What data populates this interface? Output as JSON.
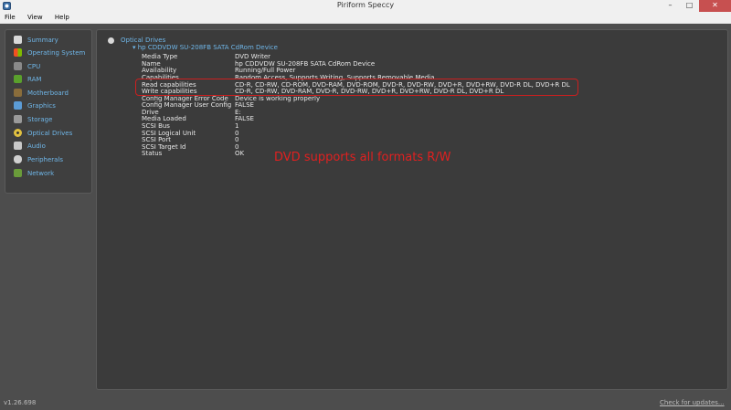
{
  "window": {
    "title": "Piriform Speccy"
  },
  "menu": [
    "File",
    "View",
    "Help"
  ],
  "sidebar": {
    "items": [
      {
        "label": "Summary",
        "icon": "summary-icon",
        "color": "#d9d9d9"
      },
      {
        "label": "Operating System",
        "icon": "windows-logo-icon",
        "color": "#f25022"
      },
      {
        "label": "CPU",
        "icon": "cpu-icon",
        "color": "#8a8a8a"
      },
      {
        "label": "RAM",
        "icon": "ram-icon",
        "color": "#5aa02c"
      },
      {
        "label": "Motherboard",
        "icon": "motherboard-icon",
        "color": "#8a6d3b"
      },
      {
        "label": "Graphics",
        "icon": "graphics-card-icon",
        "color": "#5b9bd5"
      },
      {
        "label": "Storage",
        "icon": "hard-drive-icon",
        "color": "#9a9a9a"
      },
      {
        "label": "Optical Drives",
        "icon": "disc-icon",
        "color": "#e0c040"
      },
      {
        "label": "Audio",
        "icon": "speaker-icon",
        "color": "#c8c8c8"
      },
      {
        "label": "Peripherals",
        "icon": "mouse-icon",
        "color": "#d0d0d0"
      },
      {
        "label": "Network",
        "icon": "network-icon",
        "color": "#6a9c3a"
      }
    ]
  },
  "content": {
    "section_title": "Optical Drives",
    "device_title": "▾ hp CDDVDW SU-208FB SATA CdRom Device",
    "properties": [
      {
        "key": "Media Type",
        "value": "DVD Writer"
      },
      {
        "key": "Name",
        "value": "hp CDDVDW SU-208FB SATA CdRom Device"
      },
      {
        "key": "Availability",
        "value": "Running/Full Power"
      },
      {
        "key": "Capabilities",
        "value": "Random Access, Supports Writing, Supports Removable Media"
      },
      {
        "key": "Read capabilities",
        "value": "CD-R, CD-RW, CD-ROM, DVD-RAM, DVD-ROM, DVD-R, DVD-RW, DVD+R, DVD+RW, DVD-R DL, DVD+R DL"
      },
      {
        "key": "Write capabilities",
        "value": "CD-R, CD-RW, DVD-RAM, DVD-R, DVD-RW, DVD+R, DVD+RW, DVD-R DL, DVD+R DL"
      },
      {
        "key": "Config Manager Error Code",
        "value": "Device is working properly"
      },
      {
        "key": "Config Manager User Config",
        "value": "FALSE"
      },
      {
        "key": "Drive",
        "value": "E:"
      },
      {
        "key": "Media Loaded",
        "value": "FALSE"
      },
      {
        "key": "SCSI Bus",
        "value": "1"
      },
      {
        "key": "SCSI Logical Unit",
        "value": "0"
      },
      {
        "key": "SCSI Port",
        "value": "0"
      },
      {
        "key": "SCSI Target Id",
        "value": "0"
      },
      {
        "key": "Status",
        "value": "OK"
      }
    ],
    "annotation": "DVD supports all formats R/W",
    "annotation_color": "#e02020"
  },
  "footer": {
    "version": "v1.26.698",
    "update_link": "Check for updates..."
  }
}
